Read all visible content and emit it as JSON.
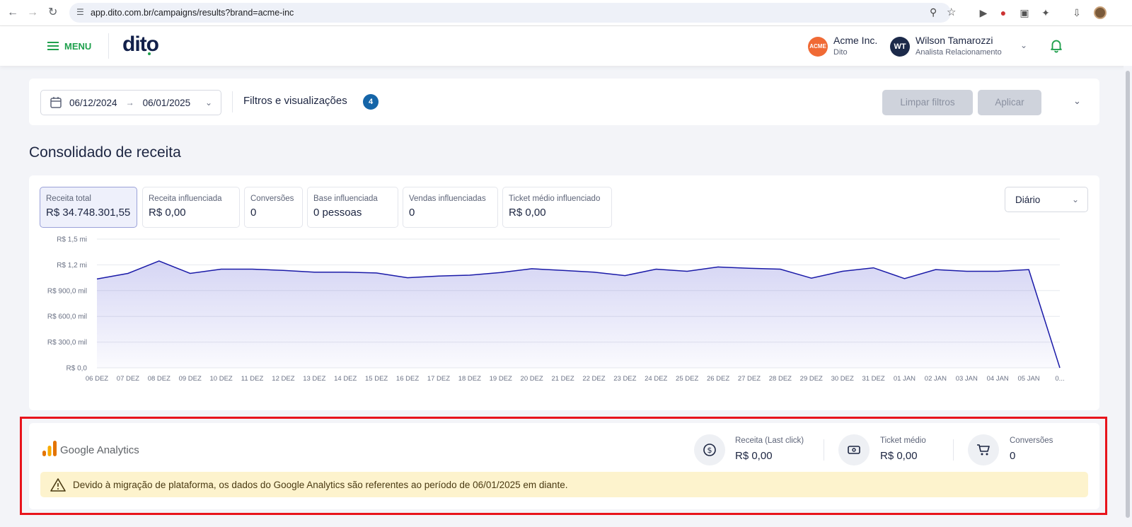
{
  "browser": {
    "url": "app.dito.com.br/campaigns/results?brand=acme-inc",
    "icons": [
      "back-icon",
      "forward-icon",
      "reload-icon",
      "site-settings-icon",
      "zoom-icon",
      "bookmark-star-icon",
      "extension-icons",
      "download-icon",
      "profile-avatar"
    ]
  },
  "header": {
    "menu_label": "MENU",
    "logo_text": "dito",
    "brand_badge": "ACME",
    "brand_name": "Acme Inc.",
    "brand_sub": "Dito",
    "user_initials": "WT",
    "user_name": "Wilson Tamarozzi",
    "user_role": "Analista Relacionamento"
  },
  "filters": {
    "date_start": "06/12/2024",
    "date_end": "06/01/2025",
    "title": "Filtros e visualizações",
    "count": "4",
    "clear_label": "Limpar filtros",
    "apply_label": "Aplicar"
  },
  "section_title": "Consolidado de receita",
  "kpis": [
    {
      "label": "Receita total",
      "value": "R$ 34.748.301,55"
    },
    {
      "label": "Receita influenciada",
      "value": "R$ 0,00"
    },
    {
      "label": "Conversões",
      "value": "0"
    },
    {
      "label": "Base influenciada",
      "value": "0 pessoas"
    },
    {
      "label": "Vendas influenciadas",
      "value": "0"
    },
    {
      "label": "Ticket médio influenciado",
      "value": "R$ 0,00"
    }
  ],
  "granularity": "Diário",
  "chart_data": {
    "type": "area",
    "y_ticks": [
      "R$ 1,5 mi",
      "R$ 1,2 mi",
      "R$ 900,0 mil",
      "R$ 600,0 mil",
      "R$ 300,0 mil",
      "R$ 0,0"
    ],
    "ylim": [
      0,
      1500000
    ],
    "x": [
      "06 DEZ",
      "07 DEZ",
      "08 DEZ",
      "09 DEZ",
      "10 DEZ",
      "11 DEZ",
      "12 DEZ",
      "13 DEZ",
      "14 DEZ",
      "15 DEZ",
      "16 DEZ",
      "17 DEZ",
      "18 DEZ",
      "19 DEZ",
      "20 DEZ",
      "21 DEZ",
      "22 DEZ",
      "23 DEZ",
      "24 DEZ",
      "25 DEZ",
      "26 DEZ",
      "27 DEZ",
      "28 DEZ",
      "29 DEZ",
      "30 DEZ",
      "31 DEZ",
      "01 JAN",
      "02 JAN",
      "03 JAN",
      "04 JAN",
      "05 JAN",
      "0..."
    ],
    "values": [
      1035000,
      1100000,
      1245000,
      1100000,
      1150000,
      1150000,
      1135000,
      1115000,
      1115000,
      1105000,
      1050000,
      1070000,
      1080000,
      1110000,
      1155000,
      1135000,
      1115000,
      1075000,
      1150000,
      1125000,
      1175000,
      1160000,
      1150000,
      1045000,
      1125000,
      1165000,
      1040000,
      1145000,
      1125000,
      1125000,
      1145000,
      0
    ],
    "line_color": "#1a1aa8",
    "grid": true
  },
  "ga": {
    "title": "Google Analytics",
    "metrics": [
      {
        "label": "Receita (Last click)",
        "value": "R$ 0,00",
        "icon": "dollar-icon"
      },
      {
        "label": "Ticket médio",
        "value": "R$ 0,00",
        "icon": "ticket-icon"
      },
      {
        "label": "Conversões",
        "value": "0",
        "icon": "cart-icon"
      }
    ],
    "notice": "Devido à migração de plataforma, os dados do Google Analytics são referentes ao período de 06/01/2025 em diante."
  }
}
